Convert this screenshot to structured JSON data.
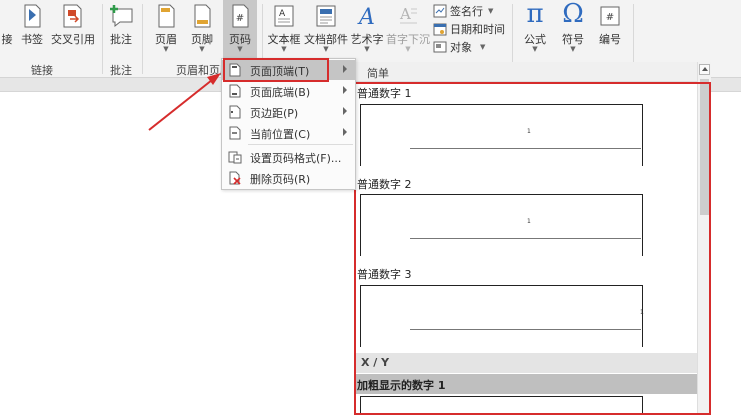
{
  "ribbon": {
    "buttons": [
      {
        "id": "cross-ref-partial",
        "label": "接"
      },
      {
        "id": "bookmark",
        "label": "书签"
      },
      {
        "id": "cross-reference",
        "label": "交叉引用"
      },
      {
        "id": "comment",
        "label": "批注"
      },
      {
        "id": "header",
        "label": "页眉"
      },
      {
        "id": "footer",
        "label": "页脚"
      },
      {
        "id": "page-number",
        "label": "页码"
      },
      {
        "id": "textbox",
        "label": "文本框"
      },
      {
        "id": "quick-parts",
        "label": "文档部件"
      },
      {
        "id": "wordart",
        "label": "艺术字"
      },
      {
        "id": "drop-cap",
        "label": "首字下沉"
      },
      {
        "id": "equation",
        "label": "公式"
      },
      {
        "id": "symbol",
        "label": "符号"
      },
      {
        "id": "numbering",
        "label": "编号"
      }
    ],
    "small_buttons": {
      "signature": "签名行",
      "datetime": "日期和时间",
      "object": "对象"
    },
    "groups": {
      "links": "链接",
      "comments": "批注",
      "header_footer": "页眉和页脚"
    },
    "glyphs": {
      "equation": "π",
      "symbol": "Ω",
      "numbering": "#",
      "wordart": "A",
      "page_number": "#"
    }
  },
  "menu": {
    "items": [
      {
        "label": "页面顶端(T)",
        "submenu": true
      },
      {
        "label": "页面底端(B)",
        "submenu": true
      },
      {
        "label": "页边距(P)",
        "submenu": true
      },
      {
        "label": "当前位置(C)",
        "submenu": true
      },
      {
        "label": "设置页码格式(F)...",
        "submenu": false
      },
      {
        "label": "删除页码(R)",
        "submenu": false
      }
    ]
  },
  "gallery": {
    "header": "简单",
    "items": [
      {
        "label": "普通数字 1",
        "number": "1"
      },
      {
        "label": "普通数字 2",
        "number": "1"
      },
      {
        "label": "普通数字 3",
        "number": "1"
      }
    ],
    "category": "X / Y",
    "bold_item": "加粗显示的数字 1"
  },
  "colors": {
    "highlight_red": "#d62c2c",
    "ribbon_bg": "#f3f3f3"
  }
}
